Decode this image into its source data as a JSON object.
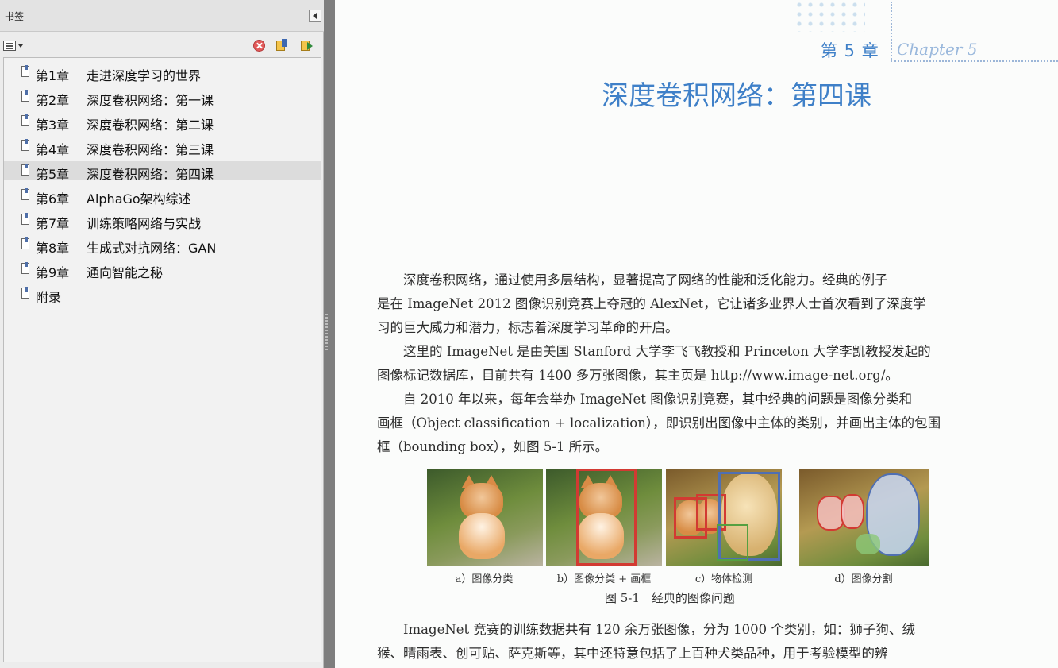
{
  "panel": {
    "title": "书签",
    "icons": {
      "collapse": "collapse-left-icon",
      "options": "options-menu-icon",
      "delete": "delete-bookmark-icon",
      "new": "new-bookmark-icon",
      "expand": "expand-bookmark-icon"
    },
    "bookmarks": [
      {
        "num": "第1章",
        "label": "走进深度学习的世界"
      },
      {
        "num": "第2章",
        "label": "深度卷积网络：第一课"
      },
      {
        "num": "第3章",
        "label": "深度卷积网络：第二课"
      },
      {
        "num": "第4章",
        "label": "深度卷积网络：第三课"
      },
      {
        "num": "第5章",
        "label": "深度卷积网络：第四课"
      },
      {
        "num": "第6章",
        "label": "AlphaGo架构综述"
      },
      {
        "num": "第7章",
        "label": "训练策略网络与实战"
      },
      {
        "num": "第8章",
        "label": "生成式对抗网络：GAN"
      },
      {
        "num": "第9章",
        "label": "通向智能之秘"
      },
      {
        "num": "附录",
        "label": ""
      }
    ],
    "selected_index": 4
  },
  "page": {
    "chapter_label": "第 5 章",
    "chapter_script": "Chapter 5",
    "title": "深度卷积网络：第四课",
    "paragraph_lines": [
      "　　深度卷积网络，通过使用多层结构，显著提高了网络的性能和泛化能力。经典的例子",
      "是在 ImageNet 2012 图像识别竞赛上夺冠的 AlexNet，它让诸多业界人士首次看到了深度学",
      "习的巨大威力和潜力，标志着深度学习革命的开启。",
      "　　这里的 ImageNet 是由美国 Stanford 大学李飞飞教授和 Princeton 大学李凯教授发起的",
      "图像标记数据库，目前共有 1400 多万张图像，其主页是 http://www.image-net.org/。",
      "　　自 2010 年以来，每年会举办 ImageNet 图像识别竞赛，其中经典的问题是图像分类和",
      "画框（Object classification + localization），即识别出图像中主体的类别，并画出主体的包围",
      "框（bounding box），如图 5-1 所示。"
    ],
    "figure": {
      "captions": [
        "a）图像分类",
        "b）图像分类 + 画框",
        "c）物体检测",
        "d）图像分割"
      ],
      "title": "图 5-1　经典的图像问题"
    },
    "after_lines": [
      "　　ImageNet 竞赛的训练数据共有 120 余万张图像，分为 1000 个类别，如：狮子狗、绒",
      "猴、晴雨表、创可贴、萨克斯等，其中还特意包括了上百种犬类品种，用于考验模型的辨"
    ]
  }
}
